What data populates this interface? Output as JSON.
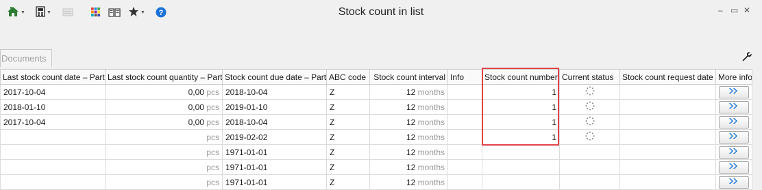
{
  "window": {
    "title": "Stock count in list",
    "home_icon": "home-icon",
    "layout_icon": "layout-icon",
    "disabled_icon": "card-icon",
    "apps_icon": "apps-grid-icon",
    "book_icon": "book-icon",
    "star_icon": "star-icon",
    "help_icon": "help-icon",
    "minimize_label": "–",
    "maximize_label": "▭",
    "close_label": "✕"
  },
  "tab": {
    "label": "Documents"
  },
  "colors": {
    "accent": "#1a73d9",
    "highlight": "#e3434a"
  },
  "columns": [
    "Last stock count date – Part",
    "Last stock count quantity – Part",
    "Stock count due date – Part",
    "ABC code",
    "Stock count interval",
    "Info",
    "Stock count number",
    "Current status",
    "Stock count request date",
    "More info"
  ],
  "rows": [
    {
      "last_date": "2017-10-04",
      "qty": "0,00",
      "qty_unit": "pcs",
      "due_date": "2018-10-04",
      "abc": "Z",
      "interval": "12",
      "interval_unit": "months",
      "info": "",
      "count_number": "1",
      "status": "pending",
      "request_date": ""
    },
    {
      "last_date": "2018-01-10",
      "qty": "0,00",
      "qty_unit": "pcs",
      "due_date": "2019-01-10",
      "abc": "Z",
      "interval": "12",
      "interval_unit": "months",
      "info": "",
      "count_number": "1",
      "status": "pending",
      "request_date": ""
    },
    {
      "last_date": "2017-10-04",
      "qty": "0,00",
      "qty_unit": "pcs",
      "due_date": "2018-10-04",
      "abc": "Z",
      "interval": "12",
      "interval_unit": "months",
      "info": "",
      "count_number": "1",
      "status": "pending",
      "request_date": ""
    },
    {
      "last_date": "",
      "qty": "",
      "qty_unit": "pcs",
      "due_date": "2019-02-02",
      "abc": "Z",
      "interval": "12",
      "interval_unit": "months",
      "info": "",
      "count_number": "1",
      "status": "pending",
      "request_date": ""
    },
    {
      "last_date": "",
      "qty": "",
      "qty_unit": "pcs",
      "due_date": "1971-01-01",
      "abc": "Z",
      "interval": "12",
      "interval_unit": "months",
      "info": "",
      "count_number": "",
      "status": "",
      "request_date": ""
    },
    {
      "last_date": "",
      "qty": "",
      "qty_unit": "pcs",
      "due_date": "1971-01-01",
      "abc": "Z",
      "interval": "12",
      "interval_unit": "months",
      "info": "",
      "count_number": "",
      "status": "",
      "request_date": ""
    },
    {
      "last_date": "",
      "qty": "",
      "qty_unit": "pcs",
      "due_date": "1971-01-01",
      "abc": "Z",
      "interval": "12",
      "interval_unit": "months",
      "info": "",
      "count_number": "",
      "status": "",
      "request_date": ""
    }
  ]
}
